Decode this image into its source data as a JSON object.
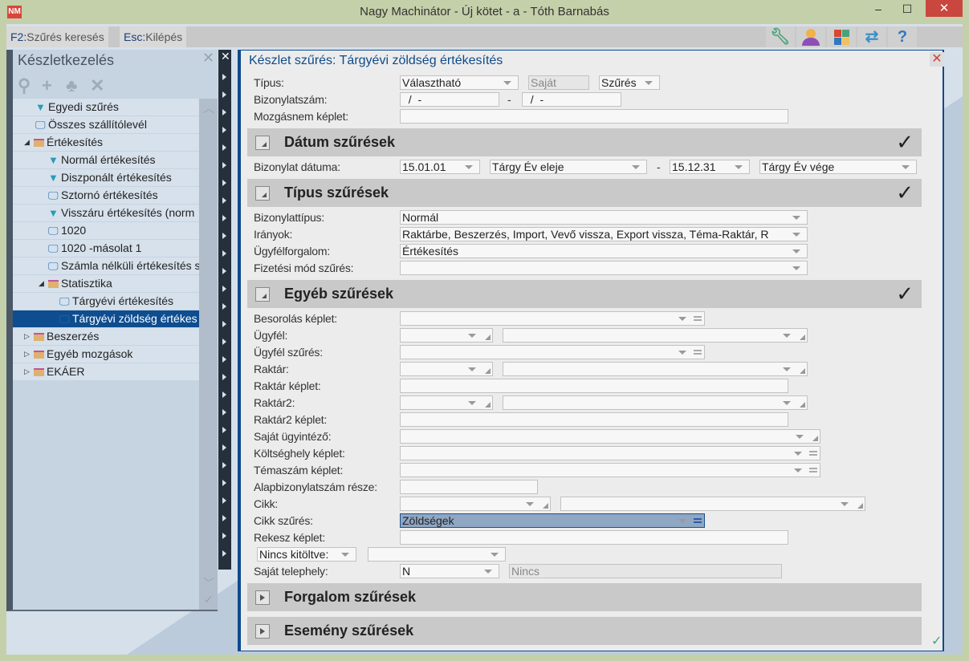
{
  "window": {
    "title": "Nagy Machinátor - Új kötet - a - Tóth Barnabás",
    "logo": "NM",
    "minimize": "‒",
    "maximize": "☐",
    "close": "✕"
  },
  "toolbar": {
    "f2_key": "F2:",
    "f2_label": "Szűrés keresés",
    "esc_key": "Esc:",
    "esc_label": "Kilépés",
    "icons": [
      "wrench-icon",
      "user-icon",
      "tiles-icon",
      "swap-arrows-icon",
      "help-icon"
    ],
    "help_glyph": "?"
  },
  "colors": {
    "accent": "#0e4a8c",
    "selected": "#0e4d8f",
    "close": "#c9473f"
  },
  "sidebar": {
    "title": "Készletkezelés",
    "close": "✕",
    "tree": [
      {
        "label": "Egyedi szűrés",
        "icon": "filter",
        "level": 1
      },
      {
        "label": "Összes szállítólevél",
        "icon": "monitor",
        "level": 1
      },
      {
        "label": "Értékesítés",
        "icon": "folder",
        "level": 0,
        "expanded": true
      },
      {
        "label": "Normál értékesítés",
        "icon": "filter",
        "level": 2
      },
      {
        "label": "Diszponált értékesítés",
        "icon": "filter",
        "level": 2
      },
      {
        "label": "Sztornó értékesítés",
        "icon": "monitor",
        "level": 2
      },
      {
        "label": "Visszáru értékesítés (norm",
        "icon": "filter",
        "level": 2
      },
      {
        "label": "1020",
        "icon": "monitor",
        "level": 2
      },
      {
        "label": "1020 -másolat 1",
        "icon": "monitor",
        "level": 2
      },
      {
        "label": "Számla nélküli értékesítés s",
        "icon": "monitor",
        "level": 2
      },
      {
        "label": "Statisztika",
        "icon": "folder",
        "level": 1,
        "expanded": true
      },
      {
        "label": "Tárgyévi értékesítés",
        "icon": "monitor",
        "level": 3
      },
      {
        "label": "Tárgyévi zöldség értékes",
        "icon": "monitor",
        "level": 3,
        "selected": true
      },
      {
        "label": "Beszerzés",
        "icon": "folder",
        "level": 0,
        "expanded": false
      },
      {
        "label": "Egyéb mozgások",
        "icon": "folder",
        "level": 0,
        "expanded": false
      },
      {
        "label": "EKÁER",
        "icon": "folder",
        "level": 0,
        "expanded": false
      }
    ]
  },
  "main": {
    "title": "Készlet szűrés: Tárgyévi zöldség értékesítés",
    "close": "✕",
    "top": {
      "tipus_label": "Típus:",
      "tipus_value": "Választható",
      "sajat": "Saját",
      "szures": "Szűrés",
      "bizszam_label": "Bizonylatszám:",
      "bizszam_from": "  /  -",
      "bizszam_to": "  /  -",
      "dash": "-",
      "mozgas_label": "Mozgásnem képlet:",
      "mozgas_value": ""
    },
    "sections": {
      "datum": {
        "title": "Dátum szűrések",
        "check": "✓",
        "label": "Bizonylat dátuma:",
        "from_date": "15.01.01",
        "from_rel": "Tárgy Év eleje",
        "to_date": "15.12.31",
        "to_rel": "Tárgy Év vége"
      },
      "tipus": {
        "title": "Típus szűrések",
        "check": "✓",
        "bizonylattipus_label": "Bizonylattípus:",
        "bizonylattipus": "Normál",
        "iranyok_label": "Irányok:",
        "iranyok": "Raktárbe, Beszerzés, Import, Vevő vissza, Export vissza, Téma-Raktár, R",
        "ugyfelforgalom_label": "Ügyfélforgalom:",
        "ugyfelforgalom": "Értékesítés",
        "fizetesi_label": "Fizetési mód szűrés:",
        "fizetesi": ""
      },
      "egyeb": {
        "title": "Egyéb szűrések",
        "check": "✓",
        "labels": [
          "Besorolás képlet:",
          "Ügyfél:",
          "Ügyfél szűrés:",
          "Raktár:",
          "Raktár képlet:",
          "Raktár2:",
          "Raktár2 képlet:",
          "Saját ügyintéző:",
          "Költséghely képlet:",
          "Témaszám képlet:",
          "Alapbizonylatszám része:",
          "Cikk:",
          "Cikk szűrés:",
          "Rekesz képlet:"
        ],
        "cikk_szures": "Zöldségek",
        "nincs_kitoltve": "Nincs kitöltve:",
        "sajat_telephely_label": "Saját telephely:",
        "sajat_telephely": "N",
        "sajat_telephely_name": "Nincs"
      },
      "forgalom": {
        "title": "Forgalom szűrések"
      },
      "esemeny": {
        "title": "Esemény szűrések"
      }
    },
    "ok_check": "✓"
  }
}
